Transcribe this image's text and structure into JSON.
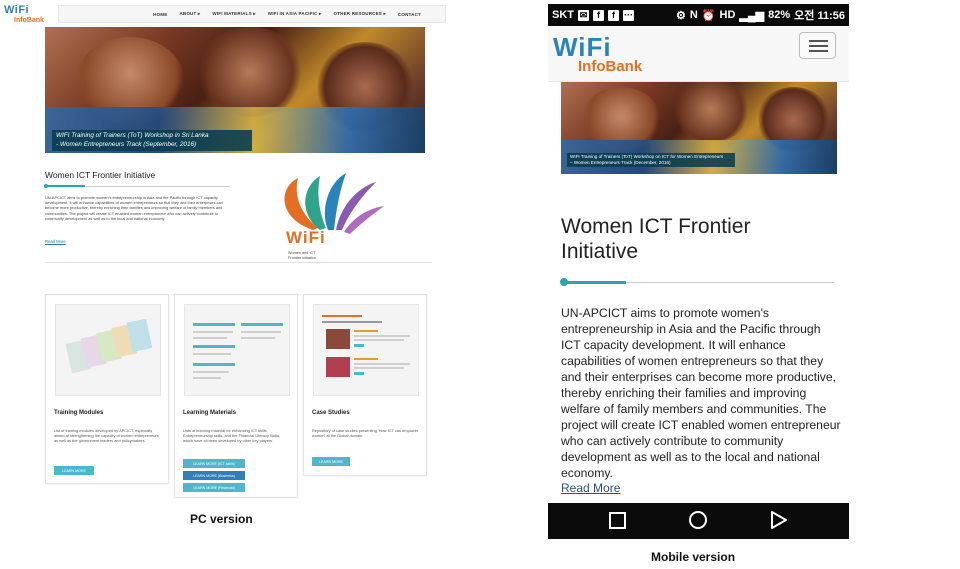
{
  "pc": {
    "logo_top": "WiFi",
    "logo_bottom": "InfoBank",
    "nav": [
      "HOME",
      "ABOUT ▸",
      "WIFI MATERIALS ▸",
      "WIFI IN ASIA PACIFIC ▸",
      "OTHER RESOURCES ▸",
      "CONTACT"
    ],
    "hero_caption": [
      "WIFI Training of Trainers (ToT) Workshop in Sri Lanka",
      "- Women Entrepreneurs Track (September, 2016)"
    ],
    "section_title": "Women ICT Frontier Initiative",
    "body": "UN-APCICT aims to promote women's entrepreneurship in Asia and the Pacific through ICT capacity development. It will enhance capabilities of women entrepreneurs so that they and their enterprises can become more productive, thereby enriching their families and improving welfare of family members and communities. The project will create ICT enabled women entrepreneur who can actively contribute to community development as well as to the local and national economy.",
    "read_more": "Read More",
    "wifi_logo_text": "WiFi",
    "wifi_logo_sub": [
      "Women and ICT",
      "Frontier Initiative"
    ],
    "cards": [
      {
        "title": "Training Modules",
        "body": "List of training modules developed by APCICT, especially aimed at strengthening the capacity of women entrepreneurs as well as the government leaders and policymakers.",
        "buttons": [
          "LEARN MORE"
        ]
      },
      {
        "title": "Learning Materials",
        "body": "Lists of learning material for enhancing ICT skills, Entrepreneurship skills, and the Financial Literacy Skills, which have all been developed by other key players.",
        "buttons": [
          "LEARN MORE (ICT skills)",
          "LEARN MORE (Business)",
          "LEARN MORE (Financial)"
        ]
      },
      {
        "title": "Case Studies",
        "body": "Repository of case studies presenting 'How ICT can empower women' at the Global domain.",
        "buttons": [
          "LEARN MORE"
        ]
      }
    ],
    "version_label": "PC version"
  },
  "mobile": {
    "status_left": [
      "SKT",
      "✉",
      "f",
      "f"
    ],
    "status_right": [
      "⚙",
      "N",
      "⏰",
      "HD",
      "82%",
      "오전 11:56"
    ],
    "logo_top": "WiFi",
    "logo_bottom": "InfoBank",
    "hero_caption": [
      "WIFI Training of Trainers (ToT) Workshop on ICT for Women Entrepreneurs",
      "– Women Entrepreneurs Track (December, 2016)"
    ],
    "section_title": "Women ICT Frontier Initiative",
    "body": "UN-APCICT aims to promote women's entrepreneurship in Asia and the Pacific through ICT capacity development. It will enhance capabilities of women entrepreneurs so that they and their enterprises can become more productive, thereby enriching their families and improving welfare of family members and communities. The project will create ICT enabled women entrepreneur who can actively contribute to community development as well as to the local and national economy.",
    "read_more": "Read More",
    "version_label": "Mobile version"
  }
}
